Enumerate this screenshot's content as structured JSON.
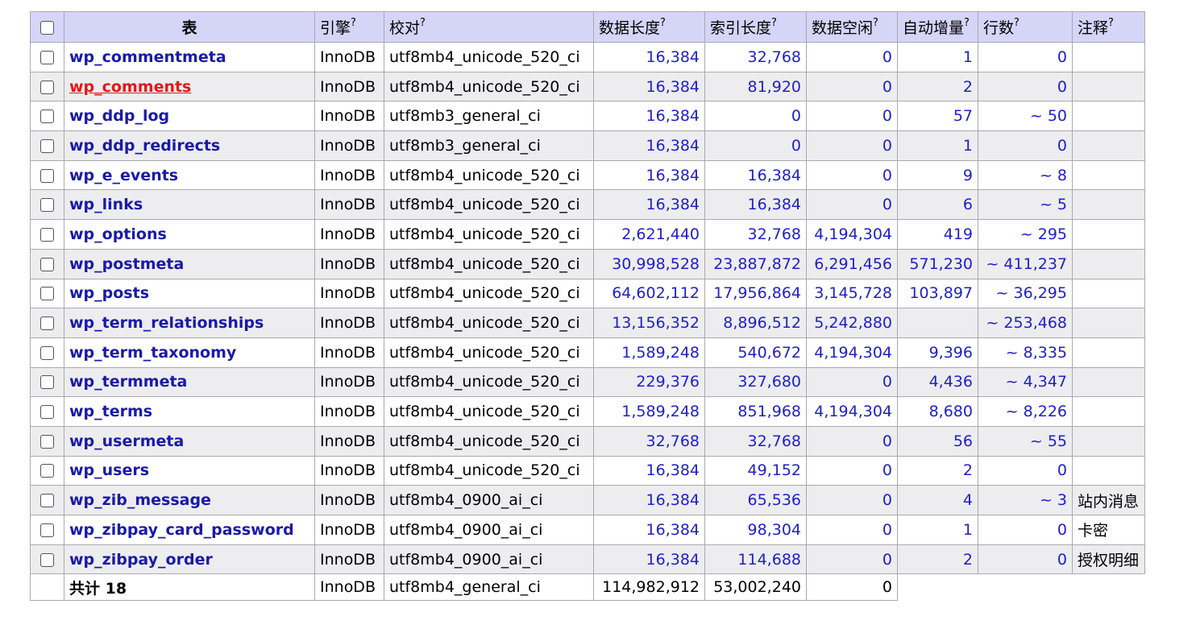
{
  "headers": {
    "table": "表",
    "engine": "引擎",
    "collation": "校对",
    "data_length": "数据长度",
    "index_length": "索引长度",
    "data_free": "数据空闲",
    "auto_increment": "自动增量",
    "rows": "行数",
    "comment": "注释",
    "help_mark": "?"
  },
  "rows": [
    {
      "name": "wp_commentmeta",
      "engine": "InnoDB",
      "collation": "utf8mb4_unicode_520_ci",
      "data_length": "16,384",
      "index_length": "32,768",
      "data_free": "0",
      "auto_increment": "1",
      "rows": "0",
      "comment": ""
    },
    {
      "name": "wp_comments",
      "engine": "InnoDB",
      "collation": "utf8mb4_unicode_520_ci",
      "data_length": "16,384",
      "index_length": "81,920",
      "data_free": "0",
      "auto_increment": "2",
      "rows": "0",
      "comment": "",
      "hover": true
    },
    {
      "name": "wp_ddp_log",
      "engine": "InnoDB",
      "collation": "utf8mb3_general_ci",
      "data_length": "16,384",
      "index_length": "0",
      "data_free": "0",
      "auto_increment": "57",
      "rows": "~ 50",
      "comment": ""
    },
    {
      "name": "wp_ddp_redirects",
      "engine": "InnoDB",
      "collation": "utf8mb3_general_ci",
      "data_length": "16,384",
      "index_length": "0",
      "data_free": "0",
      "auto_increment": "1",
      "rows": "0",
      "comment": ""
    },
    {
      "name": "wp_e_events",
      "engine": "InnoDB",
      "collation": "utf8mb4_unicode_520_ci",
      "data_length": "16,384",
      "index_length": "16,384",
      "data_free": "0",
      "auto_increment": "9",
      "rows": "~ 8",
      "comment": ""
    },
    {
      "name": "wp_links",
      "engine": "InnoDB",
      "collation": "utf8mb4_unicode_520_ci",
      "data_length": "16,384",
      "index_length": "16,384",
      "data_free": "0",
      "auto_increment": "6",
      "rows": "~ 5",
      "comment": ""
    },
    {
      "name": "wp_options",
      "engine": "InnoDB",
      "collation": "utf8mb4_unicode_520_ci",
      "data_length": "2,621,440",
      "index_length": "32,768",
      "data_free": "4,194,304",
      "auto_increment": "419",
      "rows": "~ 295",
      "comment": ""
    },
    {
      "name": "wp_postmeta",
      "engine": "InnoDB",
      "collation": "utf8mb4_unicode_520_ci",
      "data_length": "30,998,528",
      "index_length": "23,887,872",
      "data_free": "6,291,456",
      "auto_increment": "571,230",
      "rows": "~ 411,237",
      "comment": ""
    },
    {
      "name": "wp_posts",
      "engine": "InnoDB",
      "collation": "utf8mb4_unicode_520_ci",
      "data_length": "64,602,112",
      "index_length": "17,956,864",
      "data_free": "3,145,728",
      "auto_increment": "103,897",
      "rows": "~ 36,295",
      "comment": ""
    },
    {
      "name": "wp_term_relationships",
      "engine": "InnoDB",
      "collation": "utf8mb4_unicode_520_ci",
      "data_length": "13,156,352",
      "index_length": "8,896,512",
      "data_free": "5,242,880",
      "auto_increment": "",
      "rows": "~ 253,468",
      "comment": ""
    },
    {
      "name": "wp_term_taxonomy",
      "engine": "InnoDB",
      "collation": "utf8mb4_unicode_520_ci",
      "data_length": "1,589,248",
      "index_length": "540,672",
      "data_free": "4,194,304",
      "auto_increment": "9,396",
      "rows": "~ 8,335",
      "comment": ""
    },
    {
      "name": "wp_termmeta",
      "engine": "InnoDB",
      "collation": "utf8mb4_unicode_520_ci",
      "data_length": "229,376",
      "index_length": "327,680",
      "data_free": "0",
      "auto_increment": "4,436",
      "rows": "~ 4,347",
      "comment": ""
    },
    {
      "name": "wp_terms",
      "engine": "InnoDB",
      "collation": "utf8mb4_unicode_520_ci",
      "data_length": "1,589,248",
      "index_length": "851,968",
      "data_free": "4,194,304",
      "auto_increment": "8,680",
      "rows": "~ 8,226",
      "comment": ""
    },
    {
      "name": "wp_usermeta",
      "engine": "InnoDB",
      "collation": "utf8mb4_unicode_520_ci",
      "data_length": "32,768",
      "index_length": "32,768",
      "data_free": "0",
      "auto_increment": "56",
      "rows": "~ 55",
      "comment": ""
    },
    {
      "name": "wp_users",
      "engine": "InnoDB",
      "collation": "utf8mb4_unicode_520_ci",
      "data_length": "16,384",
      "index_length": "49,152",
      "data_free": "0",
      "auto_increment": "2",
      "rows": "0",
      "comment": ""
    },
    {
      "name": "wp_zib_message",
      "engine": "InnoDB",
      "collation": "utf8mb4_0900_ai_ci",
      "data_length": "16,384",
      "index_length": "65,536",
      "data_free": "0",
      "auto_increment": "4",
      "rows": "~ 3",
      "comment": "站内消息"
    },
    {
      "name": "wp_zibpay_card_password",
      "engine": "InnoDB",
      "collation": "utf8mb4_0900_ai_ci",
      "data_length": "16,384",
      "index_length": "98,304",
      "data_free": "0",
      "auto_increment": "1",
      "rows": "0",
      "comment": "卡密"
    },
    {
      "name": "wp_zibpay_order",
      "engine": "InnoDB",
      "collation": "utf8mb4_0900_ai_ci",
      "data_length": "16,384",
      "index_length": "114,688",
      "data_free": "0",
      "auto_increment": "2",
      "rows": "0",
      "comment": "授权明细"
    }
  ],
  "footer": {
    "label": "共计 18",
    "engine": "InnoDB",
    "collation": "utf8mb4_general_ci",
    "data_length": "114,982,912",
    "index_length": "53,002,240",
    "data_free": "0"
  }
}
